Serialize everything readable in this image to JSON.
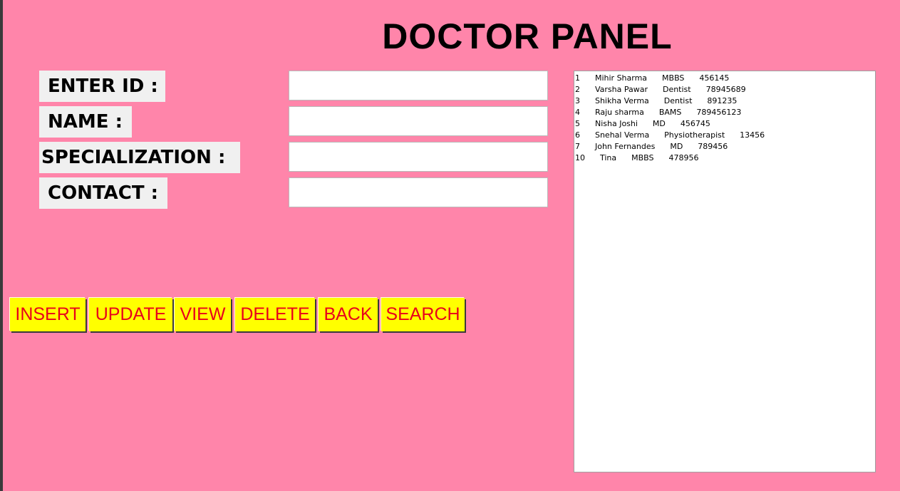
{
  "title": "DOCTOR PANEL",
  "form": {
    "id_label": "ENTER ID :",
    "name_label": "NAME :",
    "specialization_label": "SPECIALIZATION :",
    "contact_label": "CONTACT :",
    "id_value": "",
    "name_value": "",
    "specialization_value": "",
    "contact_value": ""
  },
  "buttons": {
    "insert": "INSERT",
    "update": "UPDATE",
    "view": "VIEW",
    "delete": "DELETE",
    "back": "BACK",
    "search": "SEARCH"
  },
  "records": [
    "1      Mihir Sharma      MBBS      456145",
    "2      Varsha Pawar      Dentist      78945689",
    "3      Shikha Verma      Dentist      891235",
    "4      Raju sharma      BAMS      789456123",
    "5      Nisha Joshi      MD      456745",
    "6      Snehal Verma      Physiotherapist      13456",
    "7      John Fernandes      MD      789456",
    "10      Tina      MBBS      478956"
  ],
  "colors": {
    "background": "#ff85aa",
    "button_bg": "#ffff00",
    "button_text": "#e8001c"
  }
}
